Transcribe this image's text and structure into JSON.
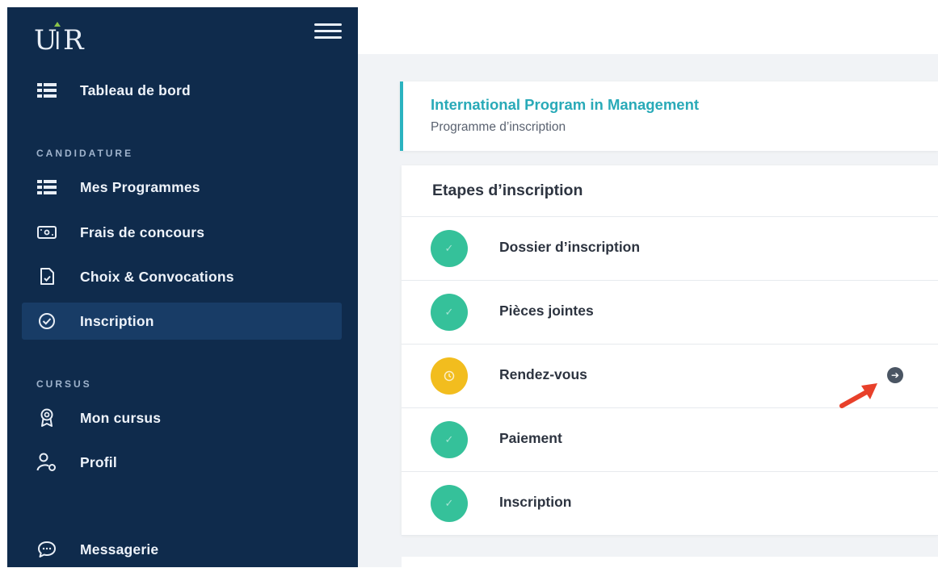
{
  "brand": {
    "logo_text": "UIR",
    "accent": "#8bc34a"
  },
  "sidebar": {
    "background": "#0f2b4c",
    "top_items": [
      {
        "label": "Tableau de bord",
        "icon": "list-icon"
      }
    ],
    "sections": [
      {
        "title": "CANDIDATURE",
        "items": [
          {
            "label": "Mes Programmes",
            "icon": "list-icon"
          },
          {
            "label": "Frais de concours",
            "icon": "money-icon"
          },
          {
            "label": "Choix & Convocations",
            "icon": "document-check-icon"
          },
          {
            "label": "Inscription",
            "icon": "check-circle-icon",
            "active": true
          }
        ]
      },
      {
        "title": "CURSUS",
        "items": [
          {
            "label": "Mon cursus",
            "icon": "award-icon"
          },
          {
            "label": "Profil",
            "icon": "user-settings-icon"
          }
        ]
      }
    ],
    "bottom_items": [
      {
        "label": "Messagerie",
        "icon": "chat-icon"
      }
    ]
  },
  "program": {
    "title": "International Program in Management",
    "subtitle": "Programme d’inscription",
    "accent": "#2bb3c0"
  },
  "steps": {
    "title": "Etapes d’inscription",
    "items": [
      {
        "label": "Dossier d’inscription",
        "status": "done",
        "icon": "check-icon"
      },
      {
        "label": "Pièces jointes",
        "status": "done",
        "icon": "check-icon"
      },
      {
        "label": "Rendez-vous",
        "status": "pending",
        "icon": "clock-icon",
        "action_icon": "arrow-right-circle-icon"
      },
      {
        "label": "Paiement",
        "status": "done",
        "icon": "check-icon"
      },
      {
        "label": "Inscription",
        "status": "done",
        "icon": "check-icon"
      }
    ],
    "colors": {
      "done": "#35c19a",
      "pending": "#f2bd1e"
    }
  },
  "annotation": {
    "icon": "red-arrow-icon",
    "color": "#e8402a"
  }
}
